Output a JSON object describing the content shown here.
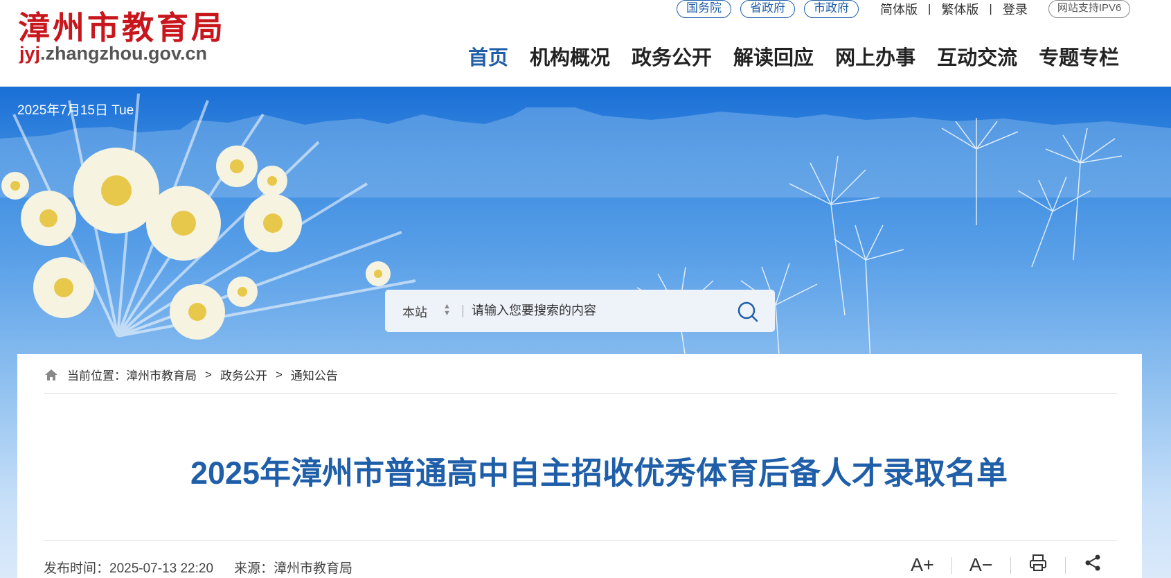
{
  "header": {
    "logo_title": "漳州市教育局",
    "logo_domain_red": "jyj",
    "logo_domain_rest": ".zhangzhou.gov.cn",
    "top_links": [
      "国务院",
      "省政府",
      "市政府"
    ],
    "simplified": "简体版",
    "traditional": "繁体版",
    "login": "登录",
    "ipv6": "网站支持IPV6",
    "separator": "|"
  },
  "nav": {
    "items": [
      {
        "label": "首页",
        "active": true
      },
      {
        "label": "机构概况"
      },
      {
        "label": "政务公开"
      },
      {
        "label": "解读回应"
      },
      {
        "label": "网上办事"
      },
      {
        "label": "互动交流"
      },
      {
        "label": "专题专栏"
      }
    ]
  },
  "banner": {
    "date": "2025年7月15日 Tue"
  },
  "search": {
    "scope": "本站",
    "placeholder": "请输入您要搜索的内容",
    "icon": "search-icon"
  },
  "breadcrumb": {
    "prefix": "当前位置：",
    "items": [
      "漳州市教育局",
      "政务公开",
      "通知公告"
    ],
    "separator": ">"
  },
  "article": {
    "title": "2025年漳州市普通高中自主招收优秀体育后备人才录取名单",
    "publish_label": "发布时间：",
    "publish_time": "2025-07-13 22:20",
    "source_label": "来源：",
    "source": "漳州市教育局"
  },
  "tools": {
    "font_increase": "A+",
    "font_decrease": "A−",
    "print_icon": "print-icon",
    "share_icon": "share-icon"
  },
  "colors": {
    "brand_red": "#c8161d",
    "brand_blue": "#1f5ea8",
    "banner_top": "#1a6fd6"
  }
}
